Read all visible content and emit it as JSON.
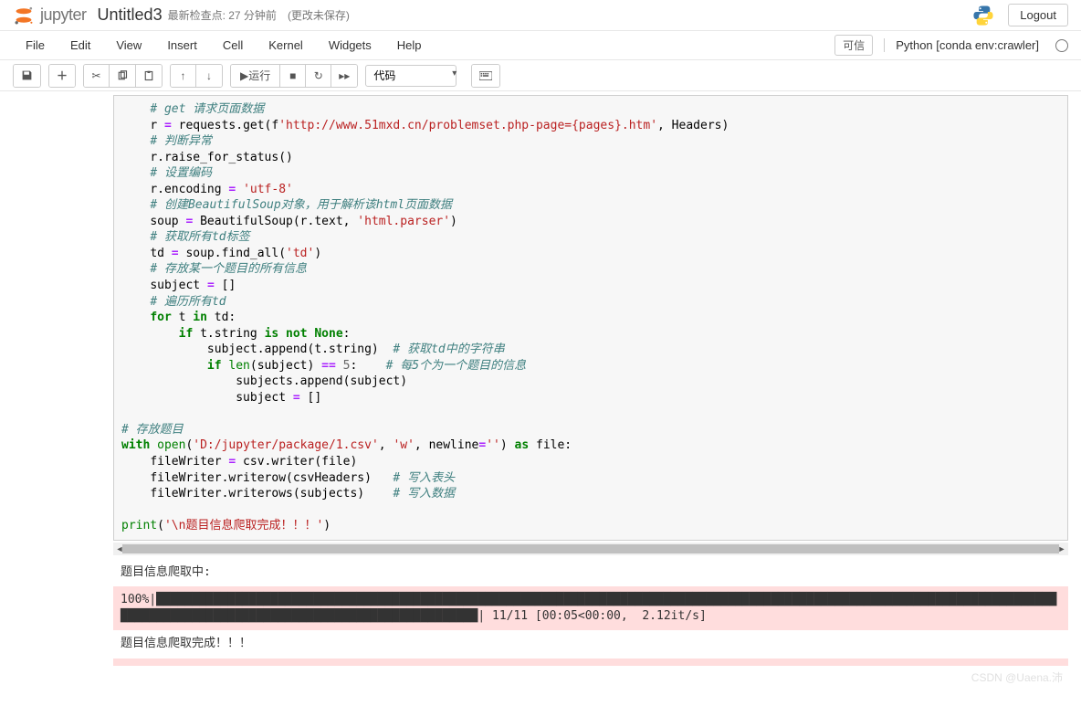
{
  "header": {
    "logo_text": "jupyter",
    "notebook_name": "Untitled3",
    "checkpoint": "最新检查点: 27 分钟前",
    "unsaved": "(更改未保存)",
    "logout": "Logout"
  },
  "menubar": {
    "items": [
      "File",
      "Edit",
      "View",
      "Insert",
      "Cell",
      "Kernel",
      "Widgets",
      "Help"
    ],
    "trusted": "可信",
    "kernel": "Python [conda env:crawler]"
  },
  "toolbar": {
    "run_label": "运行",
    "cell_type": "代码"
  },
  "code": {
    "lines": [
      {
        "indent": 1,
        "segs": [
          {
            "t": "comment",
            "v": "# get 请求页面数据"
          }
        ]
      },
      {
        "indent": 1,
        "segs": [
          {
            "t": "var",
            "v": "r "
          },
          {
            "t": "operator",
            "v": "="
          },
          {
            "t": "var",
            "v": " requests.get(f"
          },
          {
            "t": "string",
            "v": "'http://www.51mxd.cn/problemset.php-page={pages}.htm'"
          },
          {
            "t": "var",
            "v": ", Headers)"
          }
        ]
      },
      {
        "indent": 1,
        "segs": [
          {
            "t": "comment",
            "v": "# 判断异常"
          }
        ]
      },
      {
        "indent": 1,
        "segs": [
          {
            "t": "var",
            "v": "r.raise_for_status()"
          }
        ]
      },
      {
        "indent": 1,
        "segs": [
          {
            "t": "comment",
            "v": "# 设置编码"
          }
        ]
      },
      {
        "indent": 1,
        "segs": [
          {
            "t": "var",
            "v": "r.encoding "
          },
          {
            "t": "operator",
            "v": "="
          },
          {
            "t": "var",
            "v": " "
          },
          {
            "t": "string",
            "v": "'utf-8'"
          }
        ]
      },
      {
        "indent": 1,
        "segs": [
          {
            "t": "comment",
            "v": "# 创建BeautifulSoup对象，用于解析该html页面数据"
          }
        ]
      },
      {
        "indent": 1,
        "segs": [
          {
            "t": "var",
            "v": "soup "
          },
          {
            "t": "operator",
            "v": "="
          },
          {
            "t": "var",
            "v": " BeautifulSoup(r.text, "
          },
          {
            "t": "string",
            "v": "'html.parser'"
          },
          {
            "t": "var",
            "v": ")"
          }
        ]
      },
      {
        "indent": 1,
        "segs": [
          {
            "t": "comment",
            "v": "# 获取所有td标签"
          }
        ]
      },
      {
        "indent": 1,
        "segs": [
          {
            "t": "var",
            "v": "td "
          },
          {
            "t": "operator",
            "v": "="
          },
          {
            "t": "var",
            "v": " soup.find_all("
          },
          {
            "t": "string",
            "v": "'td'"
          },
          {
            "t": "var",
            "v": ")"
          }
        ]
      },
      {
        "indent": 1,
        "segs": [
          {
            "t": "comment",
            "v": "# 存放某一个题目的所有信息"
          }
        ]
      },
      {
        "indent": 1,
        "segs": [
          {
            "t": "var",
            "v": "subject "
          },
          {
            "t": "operator",
            "v": "="
          },
          {
            "t": "var",
            "v": " []"
          }
        ]
      },
      {
        "indent": 1,
        "segs": [
          {
            "t": "comment",
            "v": "# 遍历所有td"
          }
        ]
      },
      {
        "indent": 1,
        "segs": [
          {
            "t": "keyword",
            "v": "for"
          },
          {
            "t": "var",
            "v": " t "
          },
          {
            "t": "keyword",
            "v": "in"
          },
          {
            "t": "var",
            "v": " td:"
          }
        ]
      },
      {
        "indent": 2,
        "segs": [
          {
            "t": "keyword",
            "v": "if"
          },
          {
            "t": "var",
            "v": " t.string "
          },
          {
            "t": "keyword",
            "v": "is not"
          },
          {
            "t": "var",
            "v": " "
          },
          {
            "t": "keyword",
            "v": "None"
          },
          {
            "t": "var",
            "v": ":"
          }
        ]
      },
      {
        "indent": 3,
        "segs": [
          {
            "t": "var",
            "v": "subject.append(t.string)  "
          },
          {
            "t": "comment",
            "v": "# 获取td中的字符串"
          }
        ]
      },
      {
        "indent": 3,
        "segs": [
          {
            "t": "keyword",
            "v": "if"
          },
          {
            "t": "var",
            "v": " "
          },
          {
            "t": "builtin",
            "v": "len"
          },
          {
            "t": "var",
            "v": "(subject) "
          },
          {
            "t": "operator",
            "v": "=="
          },
          {
            "t": "var",
            "v": " "
          },
          {
            "t": "number",
            "v": "5"
          },
          {
            "t": "var",
            "v": ":    "
          },
          {
            "t": "comment",
            "v": "# 每5个为一个题目的信息"
          }
        ]
      },
      {
        "indent": 4,
        "segs": [
          {
            "t": "var",
            "v": "subjects.append(subject)"
          }
        ]
      },
      {
        "indent": 4,
        "segs": [
          {
            "t": "var",
            "v": "subject "
          },
          {
            "t": "operator",
            "v": "="
          },
          {
            "t": "var",
            "v": " []"
          }
        ]
      },
      {
        "indent": 0,
        "segs": [
          {
            "t": "var",
            "v": ""
          }
        ]
      },
      {
        "indent": 0,
        "segs": [
          {
            "t": "comment",
            "v": "# 存放题目"
          }
        ]
      },
      {
        "indent": 0,
        "segs": [
          {
            "t": "keyword",
            "v": "with"
          },
          {
            "t": "var",
            "v": " "
          },
          {
            "t": "builtin",
            "v": "open"
          },
          {
            "t": "var",
            "v": "("
          },
          {
            "t": "string",
            "v": "'D:/jupyter/package/1.csv'"
          },
          {
            "t": "var",
            "v": ", "
          },
          {
            "t": "string",
            "v": "'w'"
          },
          {
            "t": "var",
            "v": ", newline"
          },
          {
            "t": "operator",
            "v": "="
          },
          {
            "t": "string",
            "v": "''"
          },
          {
            "t": "var",
            "v": ") "
          },
          {
            "t": "keyword",
            "v": "as"
          },
          {
            "t": "var",
            "v": " file:"
          }
        ]
      },
      {
        "indent": 1,
        "segs": [
          {
            "t": "var",
            "v": "fileWriter "
          },
          {
            "t": "operator",
            "v": "="
          },
          {
            "t": "var",
            "v": " csv.writer(file)"
          }
        ]
      },
      {
        "indent": 1,
        "segs": [
          {
            "t": "var",
            "v": "fileWriter.writerow(csvHeaders)   "
          },
          {
            "t": "comment",
            "v": "# 写入表头"
          }
        ]
      },
      {
        "indent": 1,
        "segs": [
          {
            "t": "var",
            "v": "fileWriter.writerows(subjects)    "
          },
          {
            "t": "comment",
            "v": "# 写入数据"
          }
        ]
      },
      {
        "indent": 0,
        "segs": [
          {
            "t": "var",
            "v": ""
          }
        ]
      },
      {
        "indent": 0,
        "segs": [
          {
            "t": "builtin",
            "v": "print"
          },
          {
            "t": "var",
            "v": "("
          },
          {
            "t": "string",
            "v": "'\\n题目信息爬取完成！！！'"
          },
          {
            "t": "var",
            "v": ")"
          }
        ]
      }
    ]
  },
  "output": {
    "stdout1": "题目信息爬取中:",
    "progress_prefix": "100%|",
    "progress_bar": "████████████████████████████████████████████████████████████████████████████████████████████████████████████████████████████████████████████████████████████████████████████████",
    "progress_suffix": "| 11/11 [00:05<00:00,  2.12it/s]",
    "stdout2": "题目信息爬取完成！！！"
  },
  "watermark": "CSDN @Uaena.沛"
}
